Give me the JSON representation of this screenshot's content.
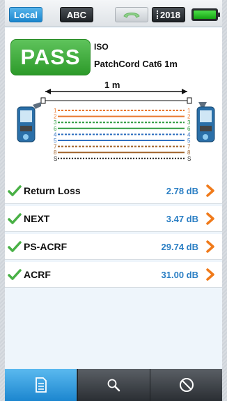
{
  "statusbar": {
    "local_label": "Local",
    "abc_label": "ABC",
    "phone_icon": "phone-icon",
    "year_label": "2018",
    "battery_icon": "battery-icon",
    "battery_level": 1.0
  },
  "result": {
    "status": "PASS",
    "standard": "ISO",
    "cable": "PatchCord Cat6 1m",
    "length": "1 m"
  },
  "wiremap": {
    "pins": [
      "1",
      "2",
      "3",
      "6",
      "4",
      "5",
      "7",
      "8",
      "S"
    ],
    "colors": [
      "#e8772e",
      "#e8772e",
      "#2e9b3f",
      "#2e9b3f",
      "#2f6fc0",
      "#2f6fc0",
      "#a0622a",
      "#a0622a",
      "#222222"
    ]
  },
  "tests": [
    {
      "name": "Return Loss",
      "value": "2.78 dB"
    },
    {
      "name": "NEXT",
      "value": "3.47 dB"
    },
    {
      "name": "PS-ACRF",
      "value": "29.74 dB"
    },
    {
      "name": "ACRF",
      "value": "31.00 dB"
    }
  ],
  "tabs": [
    {
      "icon": "document-icon",
      "active": true
    },
    {
      "icon": "search-icon",
      "active": false
    },
    {
      "icon": "cancel-icon",
      "active": false
    }
  ],
  "colors": {
    "pass_green": "#3aa836",
    "accent_blue": "#1b86cd",
    "value_blue": "#2b7fc4",
    "chevron_orange": "#f07a1a"
  }
}
